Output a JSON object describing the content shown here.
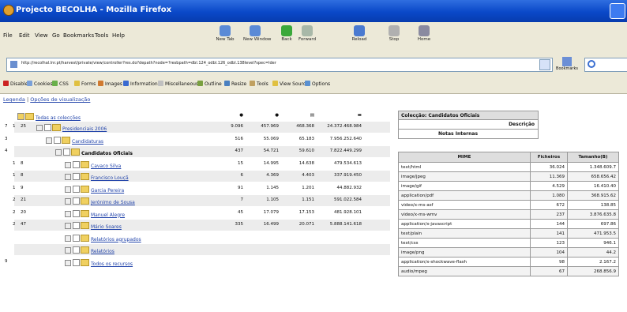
{
  "window": {
    "title": "Projecto BECOLHA - Mozilla Firefox"
  },
  "menu": [
    "File",
    "Edit",
    "View",
    "Go",
    "Bookmarks",
    "Tools",
    "Help"
  ],
  "toolbar": [
    {
      "label": "New Tab",
      "icon": "new-tab-icon",
      "color": "#5a8ad6"
    },
    {
      "label": "New Window",
      "icon": "new-window-icon",
      "color": "#5a8ad6"
    },
    {
      "label": "Back",
      "icon": "back-arrow-icon",
      "color": "#3aa83a"
    },
    {
      "label": "Forward",
      "icon": "forward-arrow-icon",
      "color": "#a8b8a8"
    },
    {
      "label": "Reload",
      "icon": "reload-icon",
      "color": "#4a7ad0"
    },
    {
      "label": "Stop",
      "icon": "stop-icon",
      "color": "#b0b0b0"
    },
    {
      "label": "Home",
      "icon": "home-icon",
      "color": "#8a8aa0"
    }
  ],
  "address": {
    "url": "http://recolhal.lnr.pt/harvest/private/view/controller?res.do?depath?node=?resbpath=dbl.124_odbl.126_odbl.138level?spec=lder"
  },
  "go_label": "Bookmarks",
  "devbar": [
    {
      "label": "Disable",
      "icon": "disable-icon",
      "color": "#cc2222"
    },
    {
      "label": "Cookies",
      "icon": "cookies-icon",
      "color": "#7aa0d8"
    },
    {
      "label": "CSS",
      "icon": "css-icon",
      "color": "#6ab04a"
    },
    {
      "label": "Forms",
      "icon": "forms-icon",
      "color": "#e0c040"
    },
    {
      "label": "Images",
      "icon": "images-icon",
      "color": "#d07a30"
    },
    {
      "label": "Information",
      "icon": "information-icon",
      "color": "#3a6ad0"
    },
    {
      "label": "Miscellaneous",
      "icon": "miscellaneous-icon",
      "color": "#c0c0c0"
    },
    {
      "label": "Outline",
      "icon": "outline-icon",
      "color": "#7aa040"
    },
    {
      "label": "Resize",
      "icon": "resize-icon",
      "color": "#4a80c0"
    },
    {
      "label": "Tools",
      "icon": "tools-icon",
      "color": "#c0a060"
    },
    {
      "label": "View Source",
      "icon": "view-source-icon",
      "color": "#e0c040"
    },
    {
      "label": "Options",
      "icon": "options-icon",
      "color": "#5a90d0"
    }
  ],
  "links": {
    "legend": "Legenda",
    "sep": "|",
    "views": "Opções de visualização"
  },
  "tree": {
    "root": "Todas as colecções",
    "root_values": [
      "9.096",
      "457.969",
      "468.368",
      "24.372.468.984"
    ],
    "rows": [
      {
        "num": [
          "7",
          "1",
          "25"
        ],
        "indent": 0,
        "name": "Presidenciais 2006",
        "link": true,
        "bold": false,
        "values": [
          "9.096",
          "457.969",
          "468.368",
          "24.372.468.984"
        ]
      },
      {
        "num": [
          "3",
          "",
          ""
        ],
        "indent": 1,
        "name": "Candidaturas",
        "link": true,
        "bold": false,
        "values": [
          "516",
          "55.069",
          "65.183",
          "7.956.252.640"
        ]
      },
      {
        "num": [
          "4",
          "",
          ""
        ],
        "indent": 2,
        "name": "Candidatos Oficiais",
        "link": false,
        "bold": true,
        "values": [
          "437",
          "54.721",
          "59.610",
          "7.822.449.299"
        ]
      },
      {
        "num": [
          "",
          "1",
          "8"
        ],
        "indent": 3,
        "name": "Cavaco Silva",
        "link": true,
        "bold": false,
        "values": [
          "15",
          "14.995",
          "14.638",
          "479.534.613"
        ]
      },
      {
        "num": [
          "",
          "1",
          "8"
        ],
        "indent": 3,
        "name": "Francisco Louçã",
        "link": true,
        "bold": false,
        "values": [
          "6",
          "4.369",
          "4.403",
          "337.919.450"
        ]
      },
      {
        "num": [
          "",
          "1",
          "9"
        ],
        "indent": 3,
        "name": "Garcia Pereira",
        "link": true,
        "bold": false,
        "values": [
          "91",
          "1.145",
          "1.201",
          "44.882.932"
        ]
      },
      {
        "num": [
          "",
          "2",
          "21"
        ],
        "indent": 3,
        "name": "Jerónimo de Sousa",
        "link": true,
        "bold": false,
        "values": [
          "7",
          "1.105",
          "1.151",
          "591.022.584"
        ]
      },
      {
        "num": [
          "",
          "2",
          "20"
        ],
        "indent": 3,
        "name": "Manuel Alegre",
        "link": true,
        "bold": false,
        "values": [
          "45",
          "17.079",
          "17.153",
          "481.928.101"
        ]
      },
      {
        "num": [
          "",
          "2",
          "47"
        ],
        "indent": 3,
        "name": "Mário Soares",
        "link": true,
        "bold": false,
        "values": [
          "335",
          "16.499",
          "20.071",
          "5.888.141.618"
        ]
      },
      {
        "num": [
          "",
          "",
          ""
        ],
        "indent": 3,
        "name": "Relatórios agrupados",
        "link": true,
        "bold": false,
        "values": [
          "",
          "",
          "",
          ""
        ]
      },
      {
        "num": [
          "",
          "",
          ""
        ],
        "indent": 3,
        "name": "Relatórios",
        "link": true,
        "bold": false,
        "values": [
          "",
          "",
          "",
          ""
        ]
      },
      {
        "num": [
          "9",
          "",
          ""
        ],
        "indent": 3,
        "name": "Todos os recursos",
        "link": true,
        "bold": false,
        "values": [
          "",
          "",
          "",
          ""
        ]
      }
    ]
  },
  "panel": {
    "title": "Colecção: Candidatos Oficiais",
    "desc_label": "Descrição",
    "notes_label": "Notas Internas",
    "headers": [
      "MIME",
      "Ficheiros",
      "Tamanho(B)"
    ],
    "rows": [
      [
        "text/html",
        "36.024",
        "1.348.609.7"
      ],
      [
        "image/jpeg",
        "11.369",
        "658.656.42"
      ],
      [
        "image/gif",
        "4.529",
        "16.410.40"
      ],
      [
        "application/pdf",
        "1.080",
        "368.915.62"
      ],
      [
        "video/x-ms-asf",
        "672",
        "138.85"
      ],
      [
        "video/x-ms-wmv",
        "237",
        "3.876.635.8"
      ],
      [
        "application/x-javascript",
        "144",
        "697.86"
      ],
      [
        "text/plain",
        "141",
        "471.953.5"
      ],
      [
        "text/css",
        "123",
        "946.1"
      ],
      [
        "image/png",
        "104",
        "44.2"
      ],
      [
        "application/x-shockwave-flash",
        "98",
        "2.167.2"
      ],
      [
        "audio/mpeg",
        "67",
        "268.856.9"
      ]
    ]
  }
}
